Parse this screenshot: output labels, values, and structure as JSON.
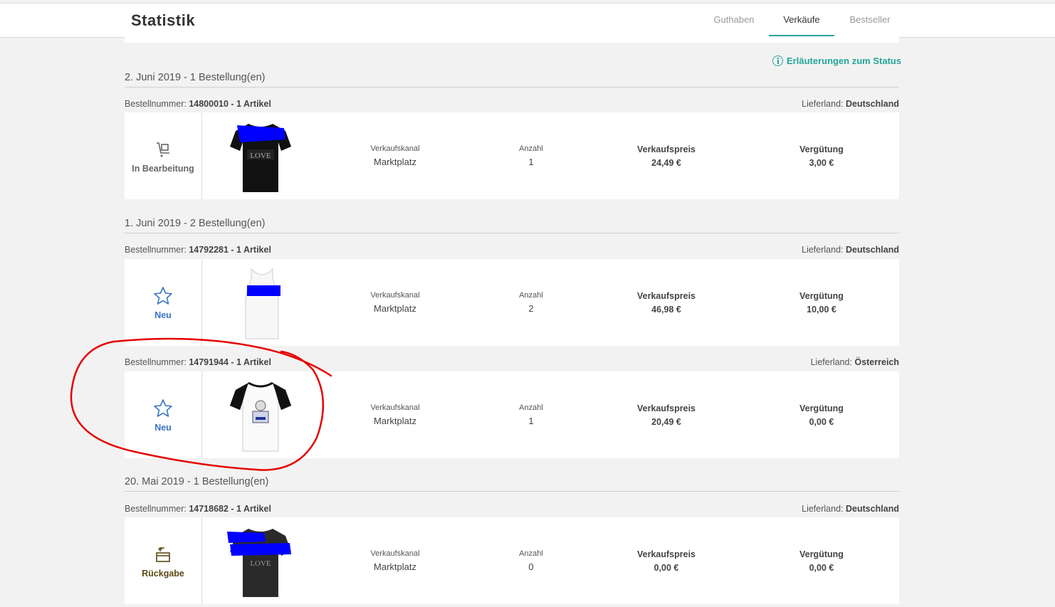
{
  "header": {
    "title": "Statistik",
    "tabs": [
      {
        "label": "Guthaben",
        "active": false
      },
      {
        "label": "Verkäufe",
        "active": true
      },
      {
        "label": "Bestseller",
        "active": false
      }
    ]
  },
  "status_link": "Erläuterungen zum Status",
  "labels": {
    "order_number": "Bestellnummer:",
    "delivery_country": "Lieferland:",
    "channel": "Verkaufskanal",
    "quantity": "Anzahl",
    "price": "Verkaufspreis",
    "commission": "Vergütung"
  },
  "groups": [
    {
      "date": "2. Juni 2019 - 1 Bestellung(en)",
      "orders": [
        {
          "number": "14800010 - 1 Artikel",
          "country": "Deutschland",
          "status": "In Bearbeitung",
          "status_icon": "cart-icon",
          "product": "black-tshirt-love",
          "channel": "Marktplatz",
          "quantity": "1",
          "price": "24,49 €",
          "commission": "3,00 €"
        }
      ]
    },
    {
      "date": "1. Juni 2019 - 2 Bestellung(en)",
      "orders": [
        {
          "number": "14792281 - 1 Artikel",
          "country": "Deutschland",
          "status": "Neu",
          "status_icon": "star-icon",
          "product": "white-tank-top",
          "channel": "Marktplatz",
          "quantity": "2",
          "price": "46,98 €",
          "commission": "10,00 €"
        },
        {
          "number": "14791944 - 1 Artikel",
          "country": "Österreich",
          "status": "Neu",
          "status_icon": "star-icon",
          "product": "baseball-tshirt",
          "channel": "Marktplatz",
          "quantity": "1",
          "price": "20,49 €",
          "commission": "0,00 €"
        }
      ]
    },
    {
      "date": "20. Mai 2019 - 1 Bestellung(en)",
      "orders": [
        {
          "number": "14718682 - 1 Artikel",
          "country": "Deutschland",
          "status": "Rückgabe",
          "status_icon": "return-box-icon",
          "product": "dark-grey-tshirt-love",
          "channel": "Marktplatz",
          "quantity": "0",
          "price": "0,00 €",
          "commission": "0,00 €"
        }
      ]
    }
  ],
  "colors": {
    "accent": "#26a69a",
    "status_new": "#3a74c4",
    "status_processing": "#666666",
    "status_return": "#5a4a12",
    "annotation": "#e60000",
    "redaction": "#0000ff"
  }
}
